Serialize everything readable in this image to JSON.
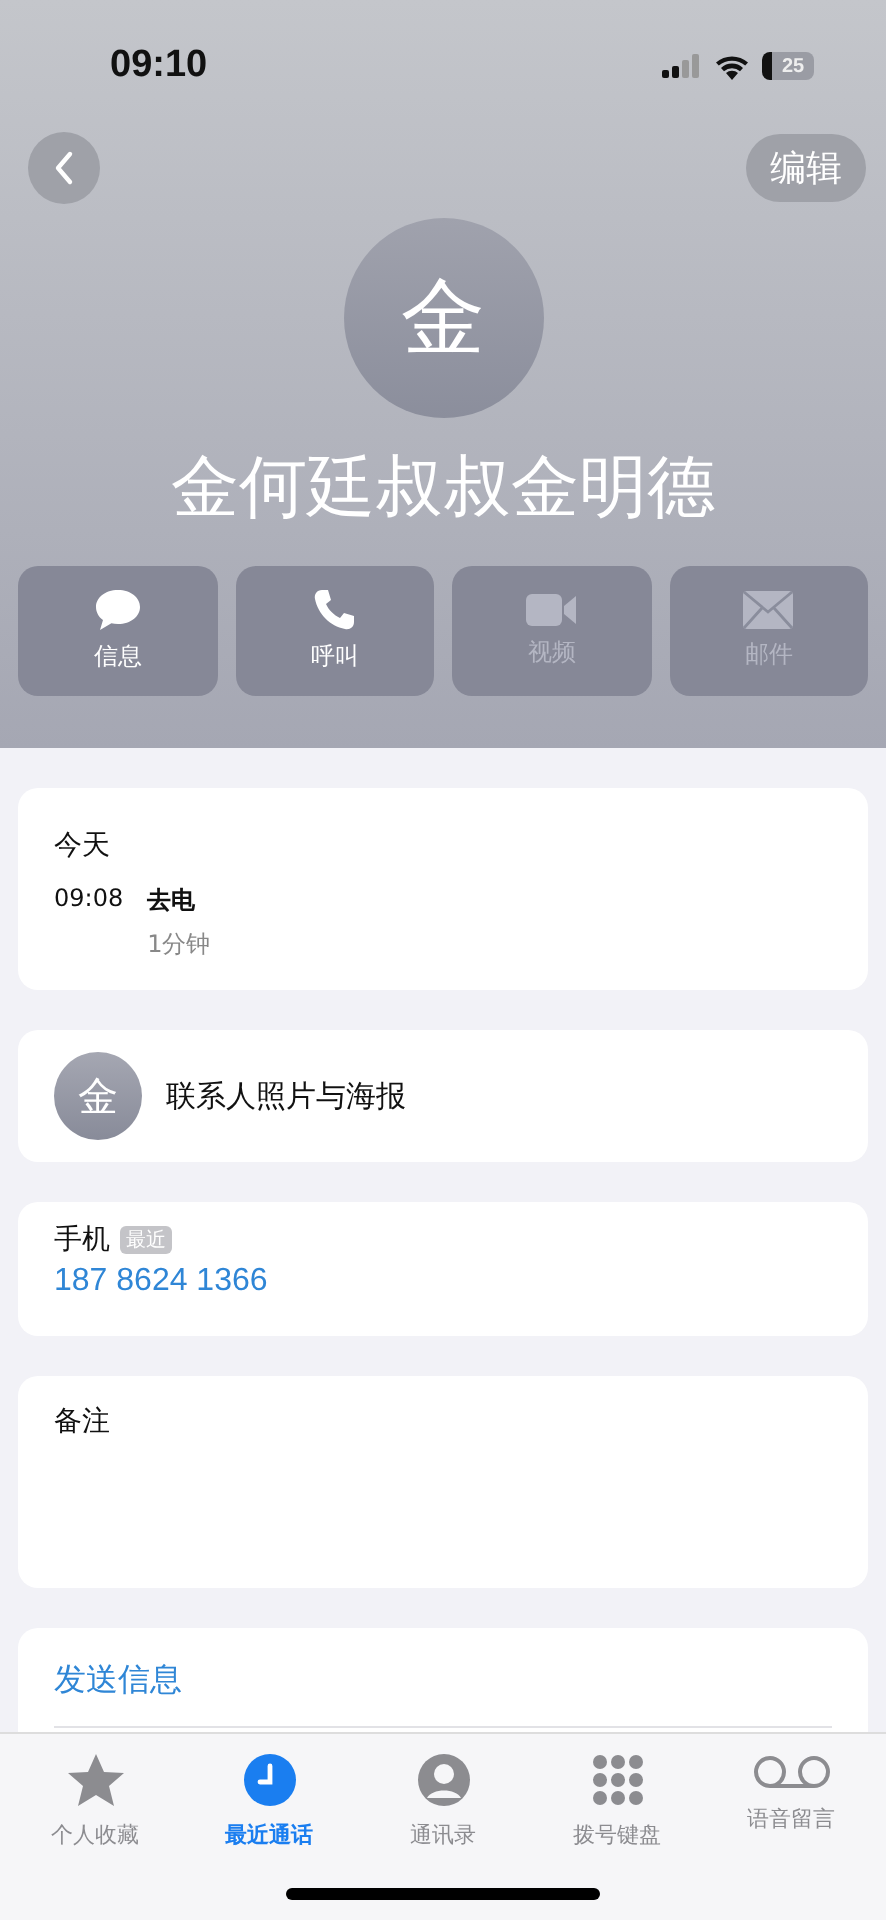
{
  "status_bar": {
    "time": "09:10",
    "battery": "25"
  },
  "nav": {
    "edit": "编辑"
  },
  "contact": {
    "initial": "金",
    "name": "金何廷叔叔金明德"
  },
  "actions": [
    {
      "kind": "message",
      "label": "信息",
      "disabled": false
    },
    {
      "kind": "call",
      "label": "呼叫",
      "disabled": false
    },
    {
      "kind": "video",
      "label": "视频",
      "disabled": true
    },
    {
      "kind": "mail",
      "label": "邮件",
      "disabled": true
    }
  ],
  "call_log": {
    "day": "今天",
    "entries": [
      {
        "time": "09:08",
        "type": "去电",
        "duration": "1分钟"
      }
    ]
  },
  "photo_row": {
    "initial": "金",
    "label": "联系人照片与海报"
  },
  "phone": {
    "label": "手机",
    "badge": "最近",
    "number": "187 8624 1366"
  },
  "notes": {
    "label": "备注"
  },
  "links": [
    "发送信息"
  ],
  "tabs": [
    {
      "kind": "star",
      "label": "个人收藏",
      "selected": false
    },
    {
      "kind": "clock",
      "label": "最近通话",
      "selected": true
    },
    {
      "kind": "person",
      "label": "通讯录",
      "selected": false
    },
    {
      "kind": "keypad",
      "label": "拨号键盘",
      "selected": false
    },
    {
      "kind": "voicemail",
      "label": "语音留言",
      "selected": false
    }
  ]
}
